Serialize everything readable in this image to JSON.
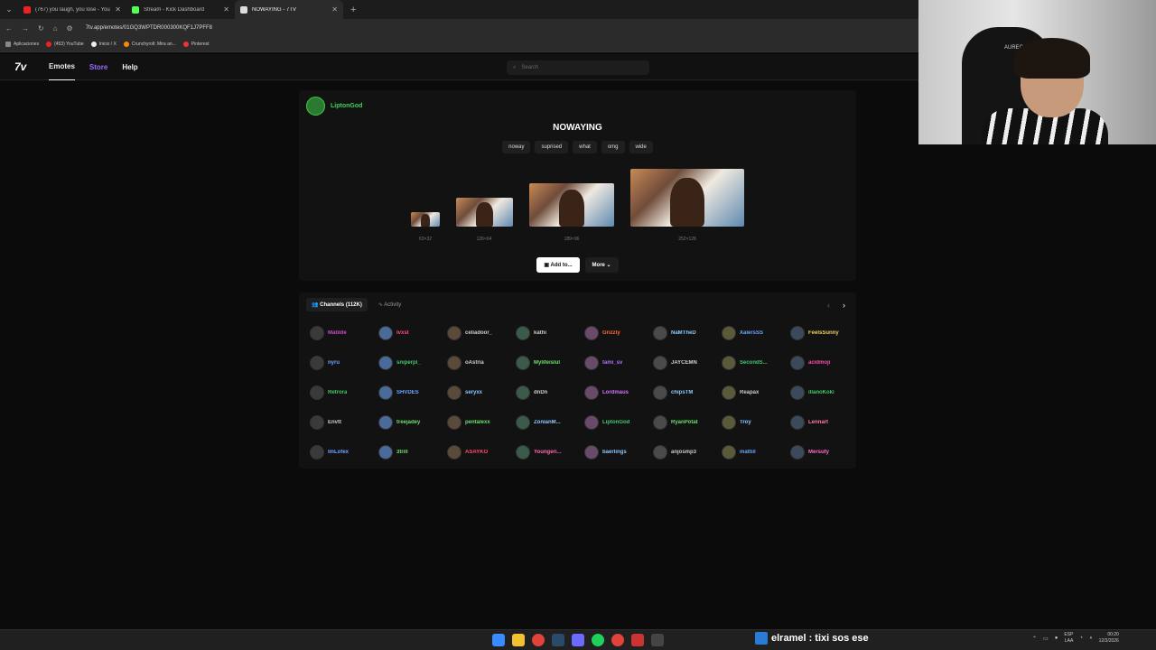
{
  "browser": {
    "tabs": [
      {
        "title": "(767) you laugh, you lose - You",
        "color": "#e22"
      },
      {
        "title": "Stream - Kick Dashboard",
        "color": "#5f5"
      },
      {
        "title": "NOWAYING - 7TV",
        "color": "#ddd"
      }
    ],
    "url": "7tv.app/emotes/01GQ3WPTDR000300KQF1J7PFF8",
    "bookmarks": [
      {
        "label": "Aplicaciones",
        "color": "#888"
      },
      {
        "label": "(453) YouTube",
        "color": "#e22"
      },
      {
        "label": "Inicio / X",
        "color": "#eee"
      },
      {
        "label": "Crunchyroll: Mira an...",
        "color": "#f80"
      },
      {
        "label": "Pinterest",
        "color": "#e33"
      }
    ]
  },
  "site": {
    "logo": "7v",
    "nav": [
      "Emotes",
      "Store",
      "Help"
    ],
    "search_placeholder": "Search"
  },
  "emote": {
    "owner": "LiptonGod",
    "name": "NOWAYING",
    "tags": [
      "noway",
      "suprised",
      "what",
      "omg",
      "wide"
    ],
    "sizes": [
      "63×32",
      "126×64",
      "189×96",
      "252×128"
    ],
    "add_label": "Add to...",
    "more_label": "More"
  },
  "channels": {
    "tab_label": "Channels (112K)",
    "activity_label": "Activity",
    "list": [
      {
        "name": "Matilde",
        "color": "#d04ac8"
      },
      {
        "name": "Ivxst",
        "color": "#ff4a8a"
      },
      {
        "name": "celiadoor_",
        "color": "#cccccc"
      },
      {
        "name": "kathi",
        "color": "#cccccc"
      },
      {
        "name": "Grizzly",
        "color": "#ff6a3a"
      },
      {
        "name": "NaMTheD",
        "color": "#8bc8ff"
      },
      {
        "name": "XalersSS",
        "color": "#6aa6ff"
      },
      {
        "name": "FeelsSunny",
        "color": "#f0d060"
      },
      {
        "name": "nyru",
        "color": "#6aa6ff"
      },
      {
        "name": "sniperpl_",
        "color": "#43c86a"
      },
      {
        "name": "oAstria",
        "color": "#cccccc"
      },
      {
        "name": "Mylifeislul",
        "color": "#6ae06a"
      },
      {
        "name": "tami_sv",
        "color": "#b070ff"
      },
      {
        "name": "JAYCEMN",
        "color": "#cccccc"
      },
      {
        "name": "SecondS...",
        "color": "#43c86a"
      },
      {
        "name": "acidmoji",
        "color": "#ff4ab0"
      },
      {
        "name": "Retrora",
        "color": "#43c86a"
      },
      {
        "name": "SHVDES",
        "color": "#6aa6ff"
      },
      {
        "name": "seryxx",
        "color": "#8bc8ff"
      },
      {
        "name": "dnDn",
        "color": "#cccccc"
      },
      {
        "name": "Lordmaus",
        "color": "#d070ff"
      },
      {
        "name": "chipsTM",
        "color": "#8bc8ff"
      },
      {
        "name": "Reapax",
        "color": "#cccccc"
      },
      {
        "name": "illanoKoki",
        "color": "#43c86a"
      },
      {
        "name": "Envtt",
        "color": "#cccccc"
      },
      {
        "name": "treejadey",
        "color": "#6ae06a"
      },
      {
        "name": "pentalexx",
        "color": "#6ae06a"
      },
      {
        "name": "ZonianM...",
        "color": "#8bc8ff"
      },
      {
        "name": "LiptonGod",
        "color": "#43c86a"
      },
      {
        "name": "RyanPotat",
        "color": "#6ae06a"
      },
      {
        "name": "Troy",
        "color": "#8bc8ff"
      },
      {
        "name": "Lennart",
        "color": "#ff7aa0"
      },
      {
        "name": "ImLofex",
        "color": "#6aa6ff"
      },
      {
        "name": "3trill",
        "color": "#6ae06a"
      },
      {
        "name": "ASAYKO",
        "color": "#ff4a6a"
      },
      {
        "name": "Youngeri...",
        "color": "#ff6ab0"
      },
      {
        "name": "baerlings",
        "color": "#8bc8ff"
      },
      {
        "name": "anjosmp3",
        "color": "#cccccc"
      },
      {
        "name": "mattiil",
        "color": "#6aa6ff"
      },
      {
        "name": "Mersufy",
        "color": "#ff6ad0"
      }
    ]
  },
  "overlay": {
    "text": "elramel : tixi sos ese"
  },
  "taskbar": {
    "lang": "ESP",
    "region": "LAA",
    "time": "00:20",
    "date": "12/3/2026"
  },
  "webcam": {
    "chair_brand": "AUREC"
  }
}
